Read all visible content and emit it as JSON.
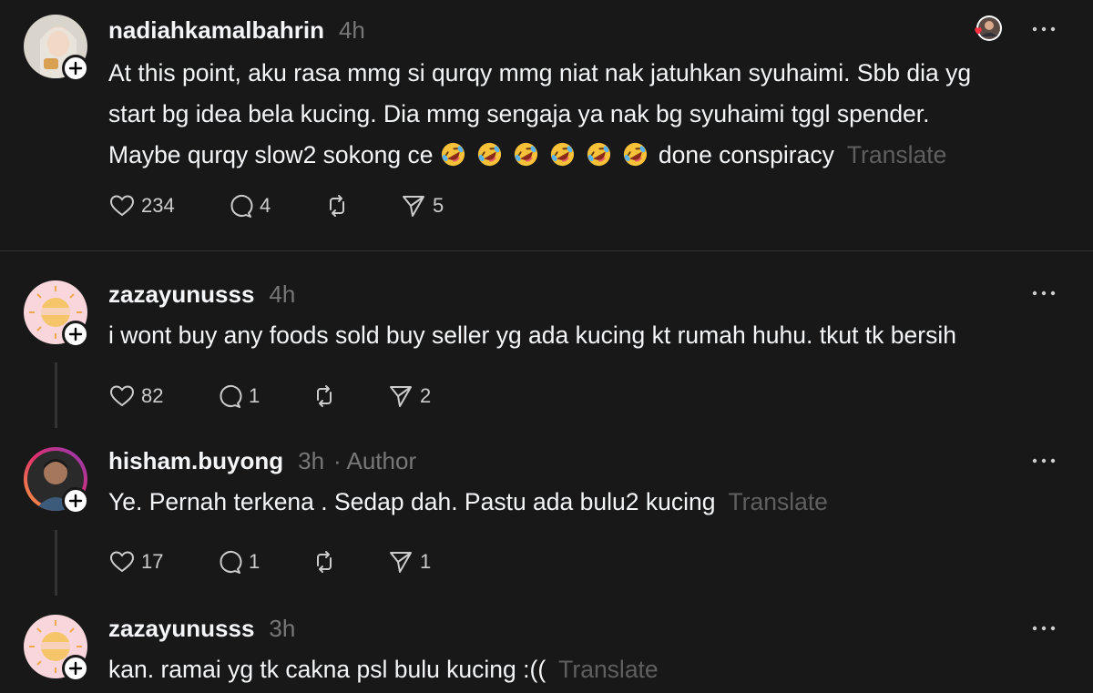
{
  "posts": [
    {
      "username": "nadiahkamalbahrin",
      "time": "4h",
      "lines": [
        "At this point, aku rasa mmg si qurqy mmg niat nak jatuhkan syuhaimi. Sbb dia yg",
        "start bg idea bela kucing. Dia mmg sengaja ya nak bg syuhaimi tggl spender.",
        "Maybe qurqy slow2 sokong ce"
      ],
      "line3_tail": "done conspiracy",
      "emojis": [
        "rofl-emoji",
        "rofl-emoji",
        "rofl-emoji",
        "rofl-emoji",
        "rofl-emoji",
        "rofl-emoji"
      ],
      "translate": "Translate",
      "likes": "234",
      "replies": "4",
      "shares": "5"
    },
    {
      "username": "zazayunusss",
      "time": "4h",
      "text": "i wont buy any foods sold buy seller yg ada kucing kt rumah huhu. tkut tk bersih",
      "likes": "82",
      "replies": "1",
      "shares": "2"
    },
    {
      "username": "hisham.buyong",
      "time": "3h",
      "author": "· Author",
      "text": "Ye. Pernah terkena . Sedap dah. Pastu ada bulu2 kucing",
      "translate": "Translate",
      "likes": "17",
      "replies": "1",
      "shares": "1"
    },
    {
      "username": "zazayunusss",
      "time": "3h",
      "text": "kan. ramai yg tk cakna psl bulu kucing :((",
      "translate": "Translate"
    }
  ],
  "colors": {
    "background": "#181818",
    "muted": "#777777",
    "liked_heart": "#ff3040"
  }
}
